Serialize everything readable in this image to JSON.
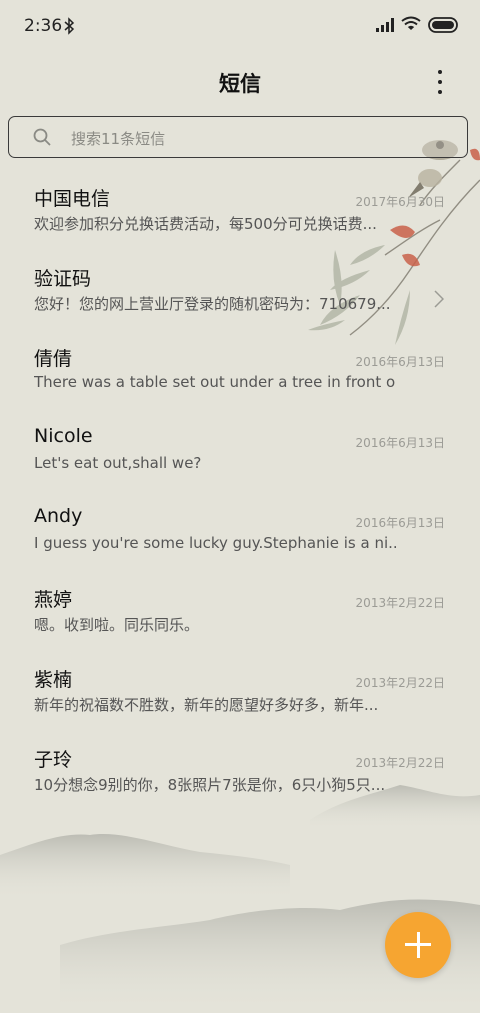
{
  "status_bar": {
    "time": "2:36"
  },
  "header": {
    "title": "短信"
  },
  "search": {
    "placeholder": "搜索11条短信"
  },
  "messages": [
    {
      "name": "中国电信",
      "date": "2017年6月30日",
      "preview": "欢迎参加积分兑换话费活动，每500分可兑换话费..."
    },
    {
      "name": "验证码",
      "date": "",
      "preview": "您好！您的网上营业厅登录的随机密码为：710679..."
    },
    {
      "name": "倩倩",
      "date": "2016年6月13日",
      "preview": "There was a table set out under a tree in front o..."
    },
    {
      "name": "Nicole",
      "date": "2016年6月13日",
      "preview": "Let's eat out,shall we?"
    },
    {
      "name": "Andy",
      "date": "2016年6月13日",
      "preview": "I guess you're some lucky guy.Stephanie is a ni..."
    },
    {
      "name": "燕婷",
      "date": "2013年2月22日",
      "preview": "嗯。收到啦。同乐同乐。"
    },
    {
      "name": "紫楠",
      "date": "2013年2月22日",
      "preview": "新年的祝福数不胜数，新年的愿望好多好多，新年..."
    },
    {
      "name": "子玲",
      "date": "2013年2月22日",
      "preview": "10分想念9别的你，8张照片7张是你，6只小狗5只..."
    }
  ],
  "colors": {
    "background": "#e4e3d9",
    "fab": "#f6a531"
  },
  "icons": {
    "fab": "plus-icon",
    "search": "search-icon",
    "more": "more-vertical-icon"
  }
}
